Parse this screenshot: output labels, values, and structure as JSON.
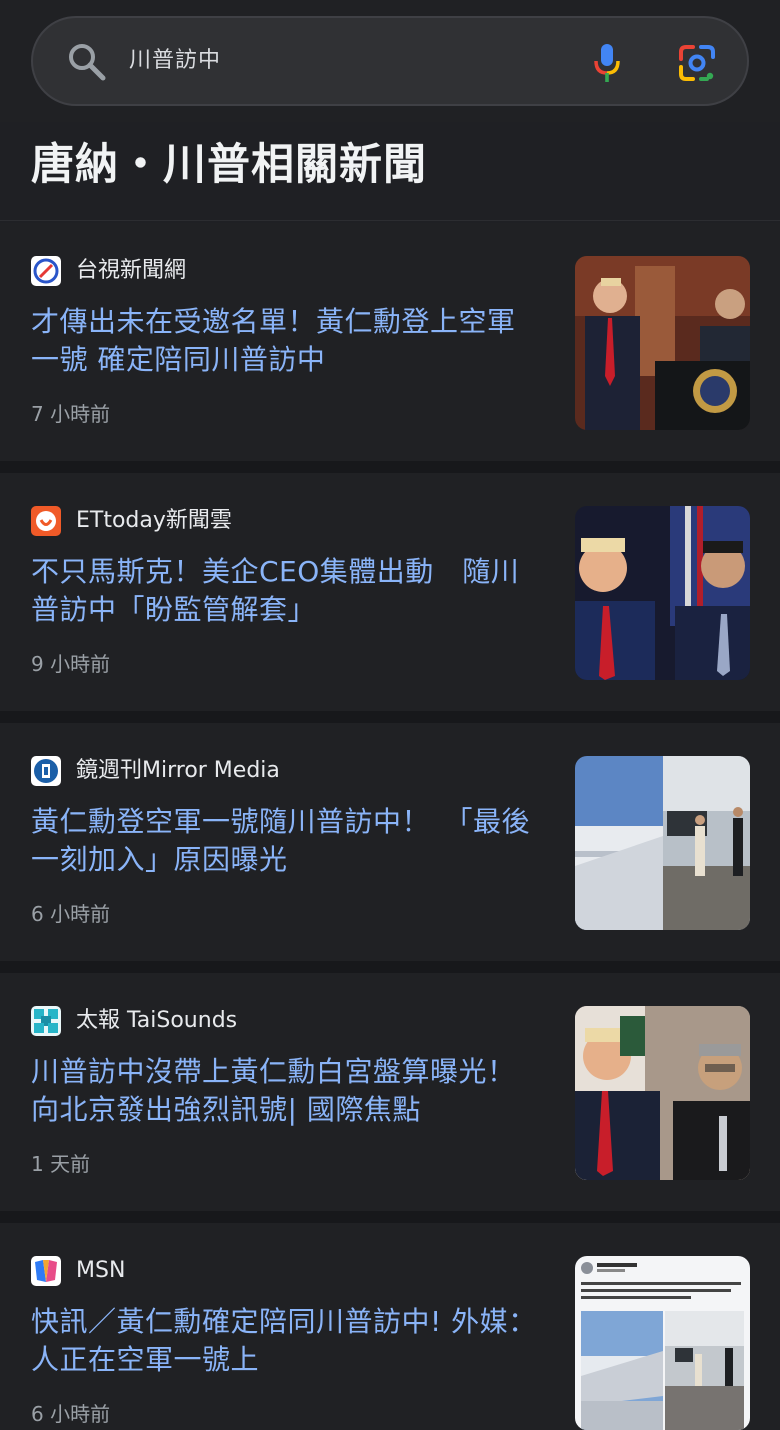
{
  "search": {
    "query": "川普訪中"
  },
  "section": {
    "title": "唐納・川普相關新聞"
  },
  "articles": [
    {
      "source": "台視新聞網",
      "title": "才傳出未在受邀名單！黃仁勳登上空軍一號 確定陪同川普訪中",
      "time": "7 小時前"
    },
    {
      "source": "ETtoday新聞雲",
      "title": "不只馬斯克！美企CEO集體出動　隨川普訪中「盼監管解套」",
      "time": "9 小時前"
    },
    {
      "source": "鏡週刊Mirror Media",
      "title": "黃仁勳登空軍一號隨川普訪中！　「最後一刻加入」原因曝光",
      "time": "6 小時前"
    },
    {
      "source": "太報 TaiSounds",
      "title": "川普訪中沒帶上黃仁勳白宮盤算曝光！向北京發出強烈訊號| 國際焦點",
      "time": "1 天前"
    },
    {
      "source": "MSN",
      "title": "快訊／黃仁勳確定陪同川普訪中! 外媒：人正在空軍一號上",
      "time": "6 小時前"
    }
  ],
  "icons": {
    "search": "search-icon",
    "mic": "microphone-icon",
    "lens": "google-lens-icon"
  },
  "colors": {
    "link": "#8ab4f8",
    "background": "#202124",
    "secondary_text": "#9aa0a6"
  }
}
